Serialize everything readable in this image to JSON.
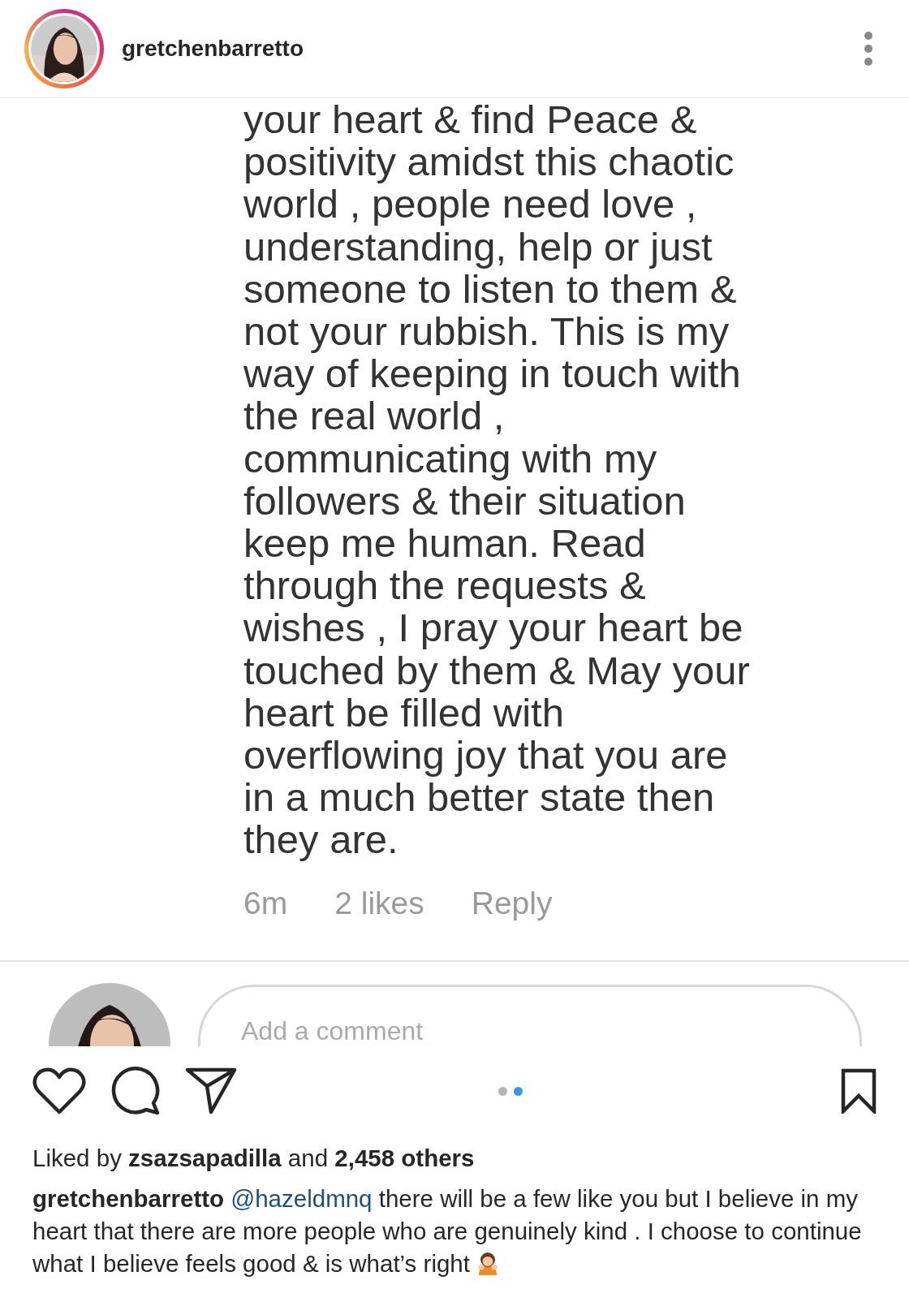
{
  "header": {
    "username": "gretchenbarretto"
  },
  "comment": {
    "text": "your heart & find Peace &\npositivity amidst this chaotic\nworld , people need love ,\nunderstanding, help or just\nsomeone to listen to them &\nnot your rubbish. This is my\nway of keeping in touch with\nthe real world ,\ncommunicating with my\nfollowers & their situation\nkeep me human. Read\nthrough the requests &\nwishes , I pray your heart be\ntouched by them & May your\nheart be filled with\noverflowing joy that you are\nin a much better state then\nthey are.",
    "time": "6m",
    "likes": "2 likes",
    "reply": "Reply"
  },
  "comment_input": {
    "placeholder": "Add a comment"
  },
  "pages": [
    {
      "selected": false
    },
    {
      "selected": true
    }
  ],
  "likes": "Liked by **zsazsapadilla** and **2,458 others**",
  "caption": {
    "username": "gretchenbarretto",
    "mention": "@hazeldmnq",
    "text": " there will be a few like you but I believe in my heart that there are more people who are genuinely kind . I choose to continue what I believe feels good & is what’s right"
  }
}
